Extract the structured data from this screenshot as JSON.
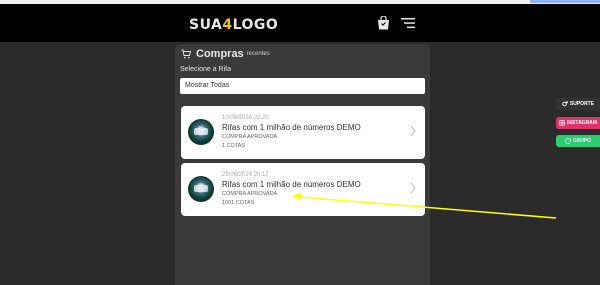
{
  "header": {
    "logo_main": "SUA",
    "logo_accent": "4",
    "logo_tail": "LOGO"
  },
  "page": {
    "title": "Compras",
    "subtitle": "recentes",
    "select_label": "Selecione a Rifa",
    "select_value": "Mostrar Todas"
  },
  "purchases": [
    {
      "date": "10/06/2024 22:20",
      "title": "Rifas com 1 milhão de números DEMO",
      "status": "COMPRA APROVADA",
      "cotas": "1 COTAS"
    },
    {
      "date": "25/06/2024 20:17",
      "title": "Rifas com 1 milhão de números DEMO",
      "status": "COMPRA APROVADA",
      "cotas": "1001 COTAS"
    }
  ],
  "side_buttons": {
    "suporte": "SUPORTE",
    "instagram": "INSTAGRAM",
    "grupo": "GRUPO"
  },
  "colors": {
    "annotation_arrow": "#ffff00",
    "instagram": "#e1306c",
    "grupo": "#2ecc71"
  }
}
